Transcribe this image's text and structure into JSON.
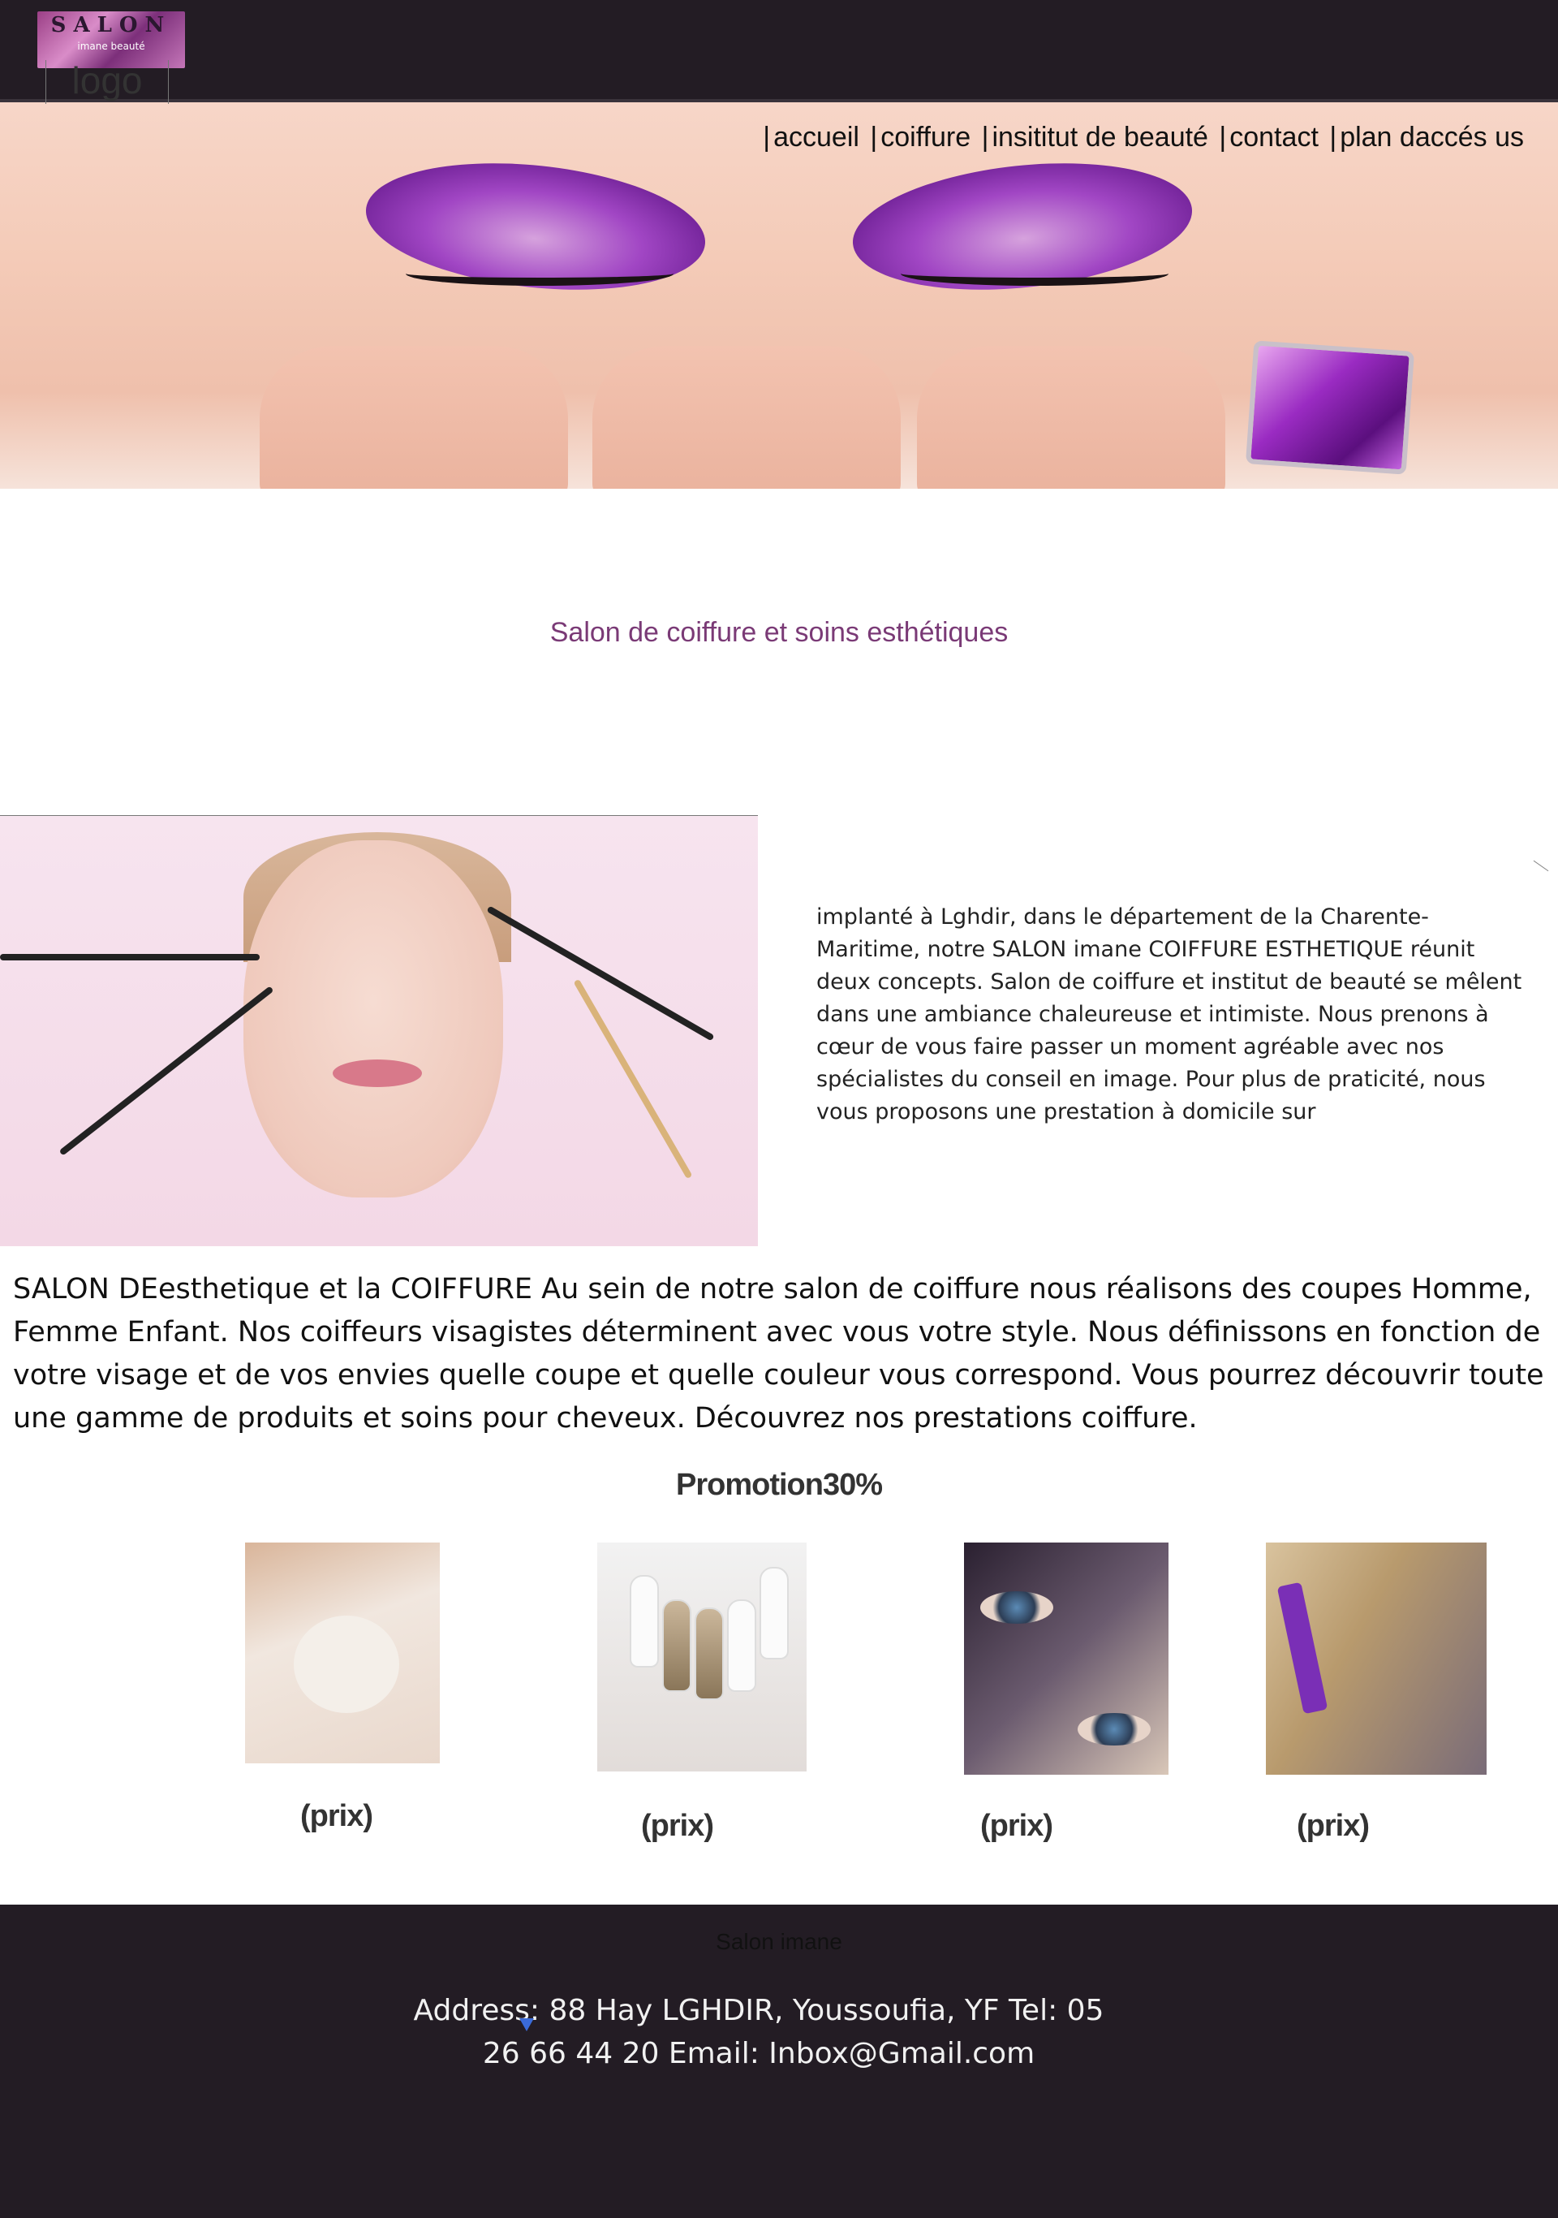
{
  "header": {
    "logo_title": "SALON",
    "logo_subtitle": "imane beauté",
    "logo_placeholder": "logo"
  },
  "nav": {
    "items": [
      "accueil",
      "coiffure",
      "insititut de beauté",
      "contact",
      "plan daccés us"
    ],
    "separator": "|"
  },
  "main": {
    "subtitle": "Salon de coiffure et soins esthétiques",
    "intro": "implanté à Lghdir, dans le département de la Charente-Maritime, notre SALON imane COIFFURE ESTHETIQUE réunit deux concepts. Salon de coiffure et institut de beauté se mêlent dans une ambiance chaleureuse et intimiste. Nous prenons à cœur de vous faire passer un moment agréable avec nos spécialistes du conseil en image. Pour plus de praticité, nous vous proposons une prestation à domicile sur",
    "long_text": "SALON DEesthetique et la COIFFURE Au sein de notre salon de coiffure nous réalisons des coupes Homme, Femme Enfant. Nos coiffeurs visagistes déterminent avec vous votre style. Nous définissons en fonction de votre visage et de vos envies quelle coupe et quelle couleur vous correspond. Vous pourrez découvrir toute une gamme de produits et soins pour cheveux. Découvrez nos prestations coiffure."
  },
  "promotion": {
    "title": "Promotion30%",
    "cards": [
      {
        "image": "facial-mask-photo",
        "price": "(prix)"
      },
      {
        "image": "nails-photo",
        "price": "(prix)"
      },
      {
        "image": "eye-makeup-photo",
        "price": "(prix)"
      },
      {
        "image": "hair-coloring-photo",
        "price": "(prix)"
      }
    ]
  },
  "footer": {
    "name": "Salon imane",
    "address": "Address: 88 Hay LGHDIR, Youssoufia, YF  Tel: 05 26 66 44 20  Email: Inbox@Gmail.com"
  },
  "colors": {
    "bar": "#231c24",
    "subtitle": "#7a3a76",
    "footer_text": "#f1f1f1"
  }
}
